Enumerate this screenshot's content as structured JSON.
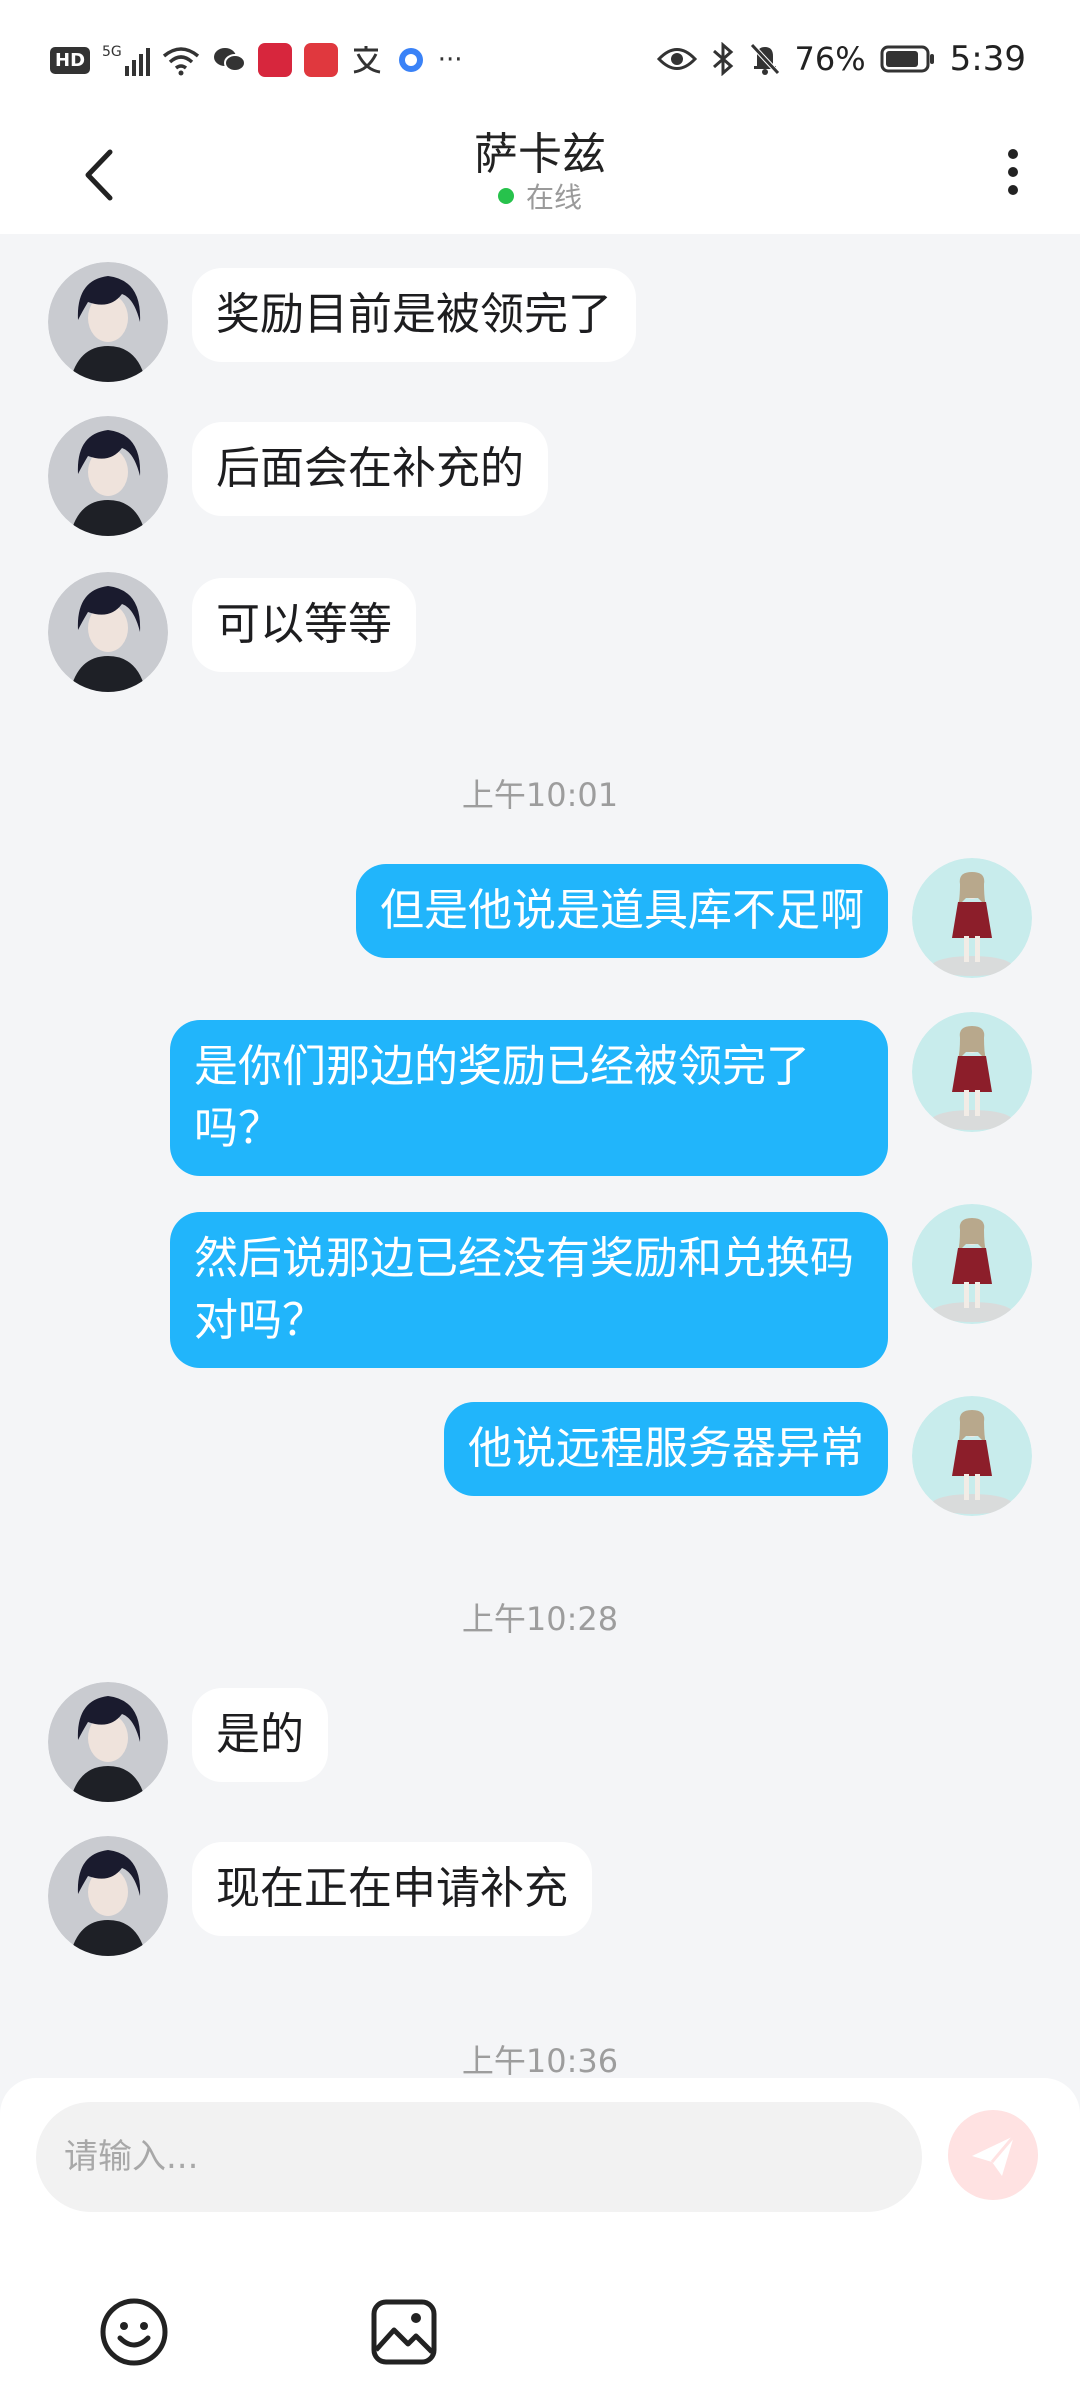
{
  "status_bar": {
    "left_label": "HD",
    "net_label": "5G",
    "battery_pct": "76%",
    "time": "5:39",
    "more": "···"
  },
  "header": {
    "title": "萨卡兹",
    "status": "在线"
  },
  "messages": [
    {
      "side": "in",
      "text": "奖励目前是被领完了"
    },
    {
      "side": "in",
      "text": "后面会在补充的"
    },
    {
      "side": "in",
      "text": "可以等等"
    },
    {
      "type": "time",
      "text": "上午10:01"
    },
    {
      "side": "out",
      "text": "但是他说是道具库不足啊"
    },
    {
      "side": "out",
      "text": "是你们那边的奖励已经被领完了吗？"
    },
    {
      "side": "out",
      "text": "然后说那边已经没有奖励和兑换码对吗？"
    },
    {
      "side": "out",
      "text": "他说远程服务器异常"
    },
    {
      "type": "time",
      "text": "上午10:28"
    },
    {
      "side": "in",
      "text": "是的"
    },
    {
      "side": "in",
      "text": "现在正在申请补充"
    },
    {
      "type": "time",
      "text": "上午10:36"
    }
  ],
  "input": {
    "placeholder": "请输入..."
  },
  "colors": {
    "accent": "#21b5fb",
    "online": "#27c24c",
    "background": "#f4f5f7",
    "send_button": "#ffe2e2"
  },
  "icons": [
    "back-arrow-icon",
    "more-vertical-icon",
    "send-icon",
    "emoji-icon",
    "image-icon"
  ]
}
